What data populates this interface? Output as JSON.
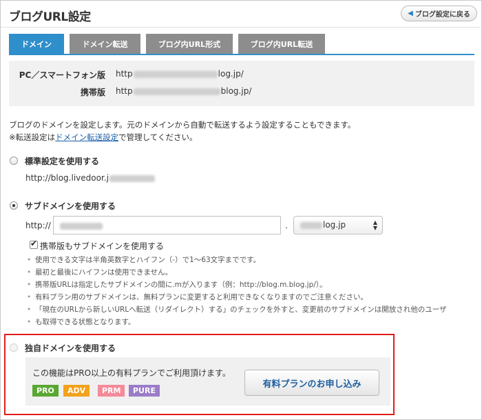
{
  "page": {
    "title": "ブログURL設定",
    "back_button": "ブログ設定に戻る"
  },
  "tabs": [
    {
      "label": "ドメイン",
      "active": true
    },
    {
      "label": "ドメイン転送",
      "active": false
    },
    {
      "label": "ブログ内URL形式",
      "active": false
    },
    {
      "label": "ブログ内URL転送",
      "active": false
    }
  ],
  "domains": {
    "pc_label": "PC／スマートフォン版",
    "pc_prefix": "http",
    "pc_suffix": "log.jp/",
    "mobile_label": "携帯版",
    "mobile_prefix": "http",
    "mobile_suffix": "blog.jp/"
  },
  "description": {
    "line1": "ブログのドメインを設定します。元のドメインから自動で転送するよう設定することもできます。",
    "line2_prefix": "※転送設定は",
    "line2_link": "ドメイン転送設定",
    "line2_suffix": "で管理してください。"
  },
  "options": {
    "standard": {
      "label": "標準設定を使用する",
      "url_prefix": "http://blog.livedoor.j",
      "selected": false
    },
    "subdomain": {
      "label": "サブドメインを使用する",
      "selected": true,
      "url_prefix": "http://",
      "input_value": "",
      "dot": ".",
      "select_value": "log.jp",
      "mobile_checkbox_label": "携帯版もサブドメインを使用する",
      "mobile_checked": true,
      "notes": [
        "使用できる文字は半角英数字とハイフン（-）で1〜63文字までです。",
        "最初と最後にハイフンは使用できません。",
        "携帯版URLは指定したサブドメインの間に.mが入ります（例：http://blog.m.blog.jp/）。",
        "有料プラン用のサブドメインは、無料プランに変更すると利用できなくなりますのでご注意ください。",
        "「現在のURLから新しいURLへ転送（リダイレクト）する」のチェックを外すと、変更前のサブドメインは開放され他のユーザ",
        "も取得できる状態となります。"
      ]
    },
    "custom": {
      "label": "独自ドメインを使用する",
      "selected": false,
      "disabled": true,
      "plan_message": "この機能はPRO以上の有料プランでご利用頂けます。",
      "apply_button": "有料プランのお申し込み"
    }
  },
  "plan_badges": [
    {
      "label": "PRO",
      "color": "#5aa832"
    },
    {
      "label": "ADV",
      "color": "#f2a21b"
    },
    {
      "label": "PRM",
      "color": "#f58a9a"
    },
    {
      "label": "PURE",
      "color": "#9b7cc7"
    }
  ],
  "colors": {
    "accent": "#2f8fcb",
    "highlight_border": "#e11b1b",
    "link": "#1a5fa8"
  }
}
